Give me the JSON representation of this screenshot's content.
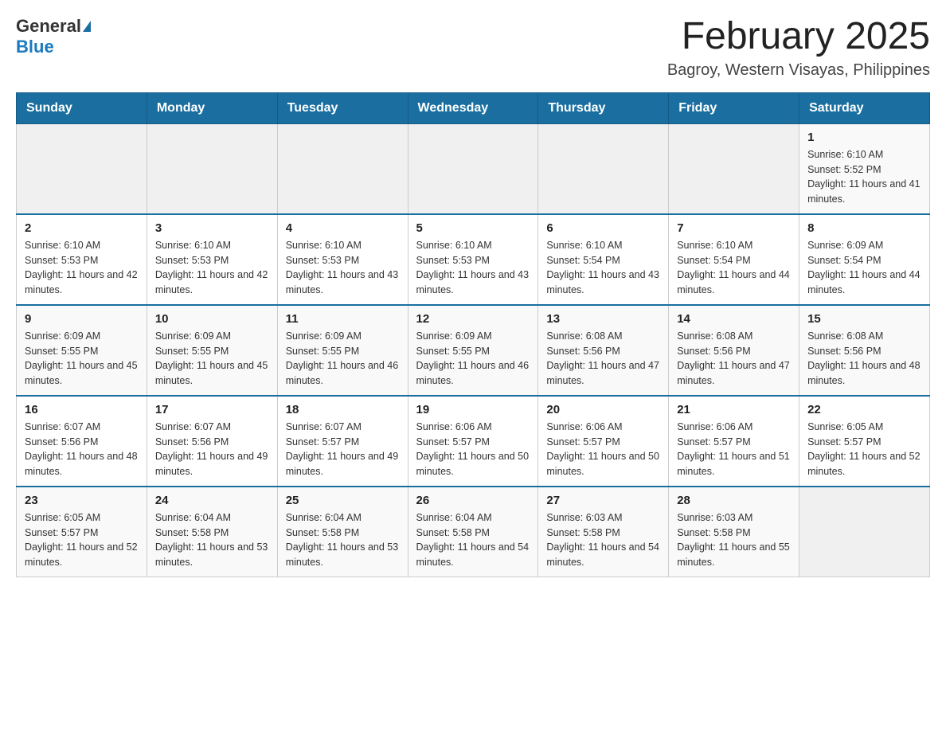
{
  "logo": {
    "general": "General",
    "blue": "Blue"
  },
  "title": {
    "month_year": "February 2025",
    "location": "Bagroy, Western Visayas, Philippines"
  },
  "weekdays": [
    "Sunday",
    "Monday",
    "Tuesday",
    "Wednesday",
    "Thursday",
    "Friday",
    "Saturday"
  ],
  "weeks": [
    [
      {
        "day": "",
        "info": ""
      },
      {
        "day": "",
        "info": ""
      },
      {
        "day": "",
        "info": ""
      },
      {
        "day": "",
        "info": ""
      },
      {
        "day": "",
        "info": ""
      },
      {
        "day": "",
        "info": ""
      },
      {
        "day": "1",
        "info": "Sunrise: 6:10 AM\nSunset: 5:52 PM\nDaylight: 11 hours and 41 minutes."
      }
    ],
    [
      {
        "day": "2",
        "info": "Sunrise: 6:10 AM\nSunset: 5:53 PM\nDaylight: 11 hours and 42 minutes."
      },
      {
        "day": "3",
        "info": "Sunrise: 6:10 AM\nSunset: 5:53 PM\nDaylight: 11 hours and 42 minutes."
      },
      {
        "day": "4",
        "info": "Sunrise: 6:10 AM\nSunset: 5:53 PM\nDaylight: 11 hours and 43 minutes."
      },
      {
        "day": "5",
        "info": "Sunrise: 6:10 AM\nSunset: 5:53 PM\nDaylight: 11 hours and 43 minutes."
      },
      {
        "day": "6",
        "info": "Sunrise: 6:10 AM\nSunset: 5:54 PM\nDaylight: 11 hours and 43 minutes."
      },
      {
        "day": "7",
        "info": "Sunrise: 6:10 AM\nSunset: 5:54 PM\nDaylight: 11 hours and 44 minutes."
      },
      {
        "day": "8",
        "info": "Sunrise: 6:09 AM\nSunset: 5:54 PM\nDaylight: 11 hours and 44 minutes."
      }
    ],
    [
      {
        "day": "9",
        "info": "Sunrise: 6:09 AM\nSunset: 5:55 PM\nDaylight: 11 hours and 45 minutes."
      },
      {
        "day": "10",
        "info": "Sunrise: 6:09 AM\nSunset: 5:55 PM\nDaylight: 11 hours and 45 minutes."
      },
      {
        "day": "11",
        "info": "Sunrise: 6:09 AM\nSunset: 5:55 PM\nDaylight: 11 hours and 46 minutes."
      },
      {
        "day": "12",
        "info": "Sunrise: 6:09 AM\nSunset: 5:55 PM\nDaylight: 11 hours and 46 minutes."
      },
      {
        "day": "13",
        "info": "Sunrise: 6:08 AM\nSunset: 5:56 PM\nDaylight: 11 hours and 47 minutes."
      },
      {
        "day": "14",
        "info": "Sunrise: 6:08 AM\nSunset: 5:56 PM\nDaylight: 11 hours and 47 minutes."
      },
      {
        "day": "15",
        "info": "Sunrise: 6:08 AM\nSunset: 5:56 PM\nDaylight: 11 hours and 48 minutes."
      }
    ],
    [
      {
        "day": "16",
        "info": "Sunrise: 6:07 AM\nSunset: 5:56 PM\nDaylight: 11 hours and 48 minutes."
      },
      {
        "day": "17",
        "info": "Sunrise: 6:07 AM\nSunset: 5:56 PM\nDaylight: 11 hours and 49 minutes."
      },
      {
        "day": "18",
        "info": "Sunrise: 6:07 AM\nSunset: 5:57 PM\nDaylight: 11 hours and 49 minutes."
      },
      {
        "day": "19",
        "info": "Sunrise: 6:06 AM\nSunset: 5:57 PM\nDaylight: 11 hours and 50 minutes."
      },
      {
        "day": "20",
        "info": "Sunrise: 6:06 AM\nSunset: 5:57 PM\nDaylight: 11 hours and 50 minutes."
      },
      {
        "day": "21",
        "info": "Sunrise: 6:06 AM\nSunset: 5:57 PM\nDaylight: 11 hours and 51 minutes."
      },
      {
        "day": "22",
        "info": "Sunrise: 6:05 AM\nSunset: 5:57 PM\nDaylight: 11 hours and 52 minutes."
      }
    ],
    [
      {
        "day": "23",
        "info": "Sunrise: 6:05 AM\nSunset: 5:57 PM\nDaylight: 11 hours and 52 minutes."
      },
      {
        "day": "24",
        "info": "Sunrise: 6:04 AM\nSunset: 5:58 PM\nDaylight: 11 hours and 53 minutes."
      },
      {
        "day": "25",
        "info": "Sunrise: 6:04 AM\nSunset: 5:58 PM\nDaylight: 11 hours and 53 minutes."
      },
      {
        "day": "26",
        "info": "Sunrise: 6:04 AM\nSunset: 5:58 PM\nDaylight: 11 hours and 54 minutes."
      },
      {
        "day": "27",
        "info": "Sunrise: 6:03 AM\nSunset: 5:58 PM\nDaylight: 11 hours and 54 minutes."
      },
      {
        "day": "28",
        "info": "Sunrise: 6:03 AM\nSunset: 5:58 PM\nDaylight: 11 hours and 55 minutes."
      },
      {
        "day": "",
        "info": ""
      }
    ]
  ]
}
